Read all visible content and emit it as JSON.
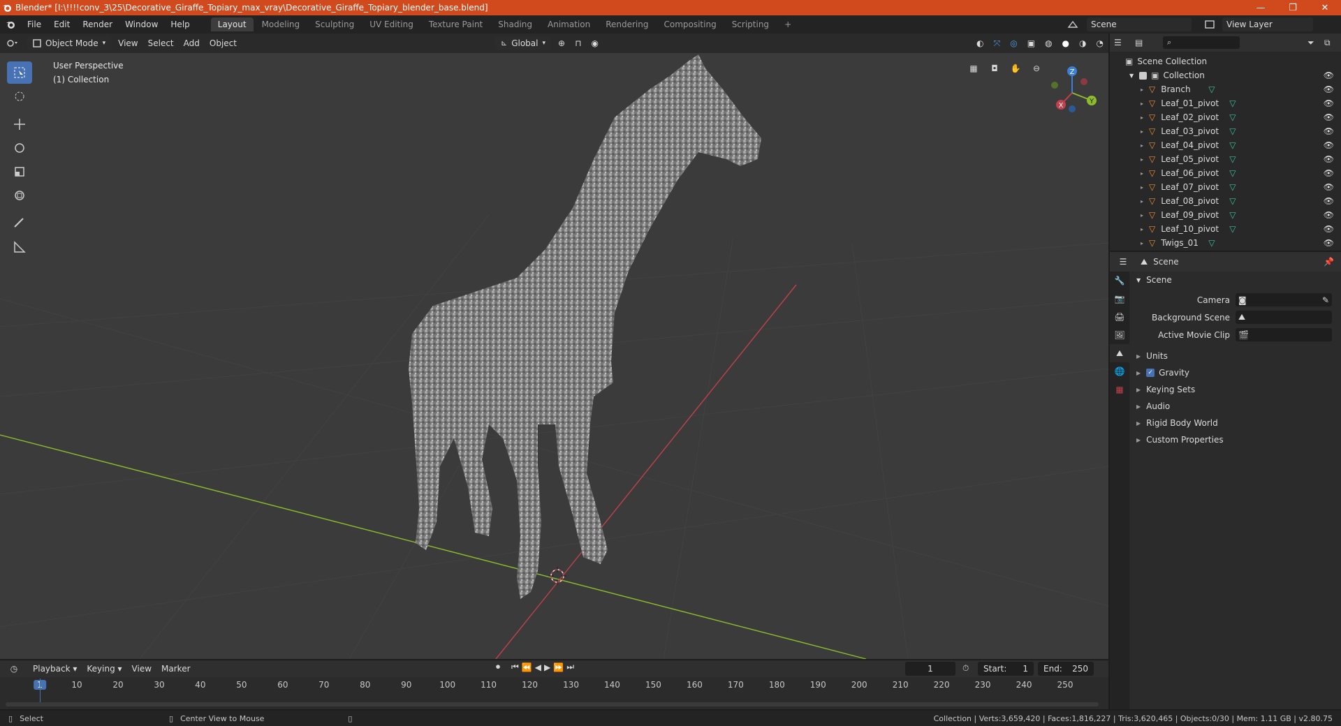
{
  "window": {
    "title": "Blender* [I:\\!!!!conv_3\\25\\Decorative_Giraffe_Topiary_max_vray\\Decorative_Giraffe_Topiary_blender_base.blend]",
    "minimize": "—",
    "maximize": "❐",
    "close": "✕"
  },
  "menubar": {
    "menus": [
      "File",
      "Edit",
      "Render",
      "Window",
      "Help"
    ],
    "workspaces": [
      "Layout",
      "Modeling",
      "Sculpting",
      "UV Editing",
      "Texture Paint",
      "Shading",
      "Animation",
      "Rendering",
      "Compositing",
      "Scripting"
    ],
    "active_workspace": "Layout",
    "add_workspace": "+",
    "scene": "Scene",
    "view_layer": "View Layer"
  },
  "viewport": {
    "mode": "Object Mode",
    "menus": [
      "View",
      "Select",
      "Add",
      "Object"
    ],
    "transform_orientation": "Global",
    "overlay_line1": "User Perspective",
    "overlay_line2": "(1) Collection",
    "gizmo": {
      "x": "X",
      "y": "Y",
      "z": "Z"
    }
  },
  "outliner": {
    "root": "Scene Collection",
    "collection": "Collection",
    "objects": [
      "Branch",
      "Leaf_01_pivot",
      "Leaf_02_pivot",
      "Leaf_03_pivot",
      "Leaf_04_pivot",
      "Leaf_05_pivot",
      "Leaf_06_pivot",
      "Leaf_07_pivot",
      "Leaf_08_pivot",
      "Leaf_09_pivot",
      "Leaf_10_pivot",
      "Twigs_01"
    ]
  },
  "properties": {
    "context": "Scene",
    "panel_title": "Scene",
    "fields": [
      {
        "label": "Camera"
      },
      {
        "label": "Background Scene"
      },
      {
        "label": "Active Movie Clip"
      }
    ],
    "subpanels": [
      "Units",
      "Gravity",
      "Keying Sets",
      "Audio",
      "Rigid Body World",
      "Custom Properties"
    ]
  },
  "timeline": {
    "menus": [
      "Playback",
      "Keying",
      "View",
      "Marker"
    ],
    "current_frame": "1",
    "start_label": "Start:",
    "start": "1",
    "end_label": "End:",
    "end": "250",
    "ticks": [
      "1",
      "10",
      "20",
      "30",
      "40",
      "50",
      "60",
      "70",
      "80",
      "90",
      "100",
      "110",
      "120",
      "130",
      "140",
      "150",
      "160",
      "170",
      "180",
      "190",
      "200",
      "210",
      "220",
      "230",
      "240",
      "250"
    ]
  },
  "statusbar": {
    "left_action": "Select",
    "mid_action": "Center View to Mouse",
    "stats": "Collection | Verts:3,659,420 | Faces:1,816,227 | Tris:3,620,465 | Objects:0/30 | Mem: 1.11 GB | v2.80.75"
  },
  "colors": {
    "titlebar": "#d04a1e",
    "accent": "#4772b3",
    "object_icon": "#e8913a",
    "mesh_icon": "#3dc1a0",
    "axis_x": "#c0414b",
    "axis_y": "#8dbb2c",
    "axis_z": "#3b7fd6"
  }
}
